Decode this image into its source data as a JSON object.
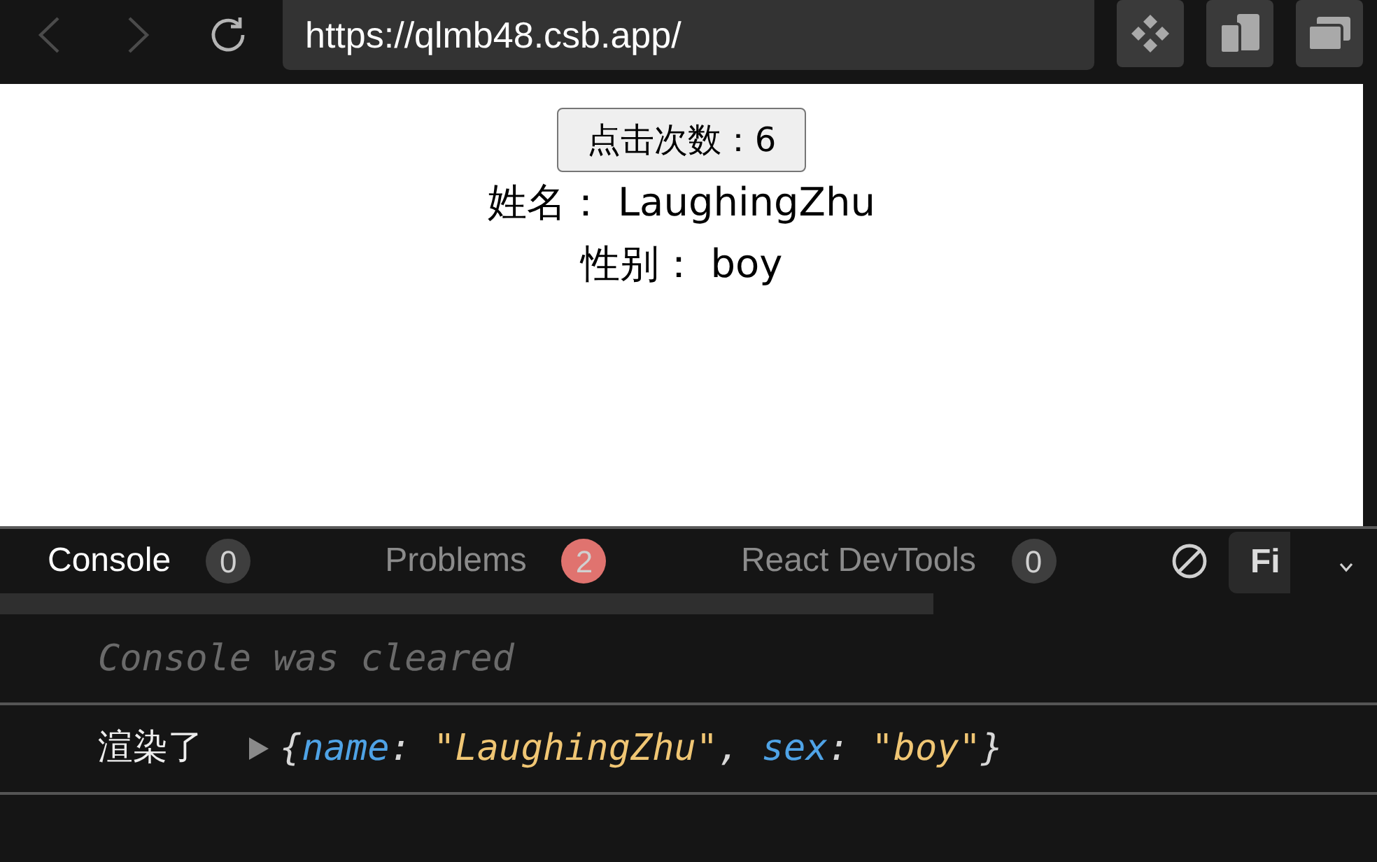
{
  "browser": {
    "nav_buttons": [
      {
        "kind": "back",
        "disabled": true
      },
      {
        "kind": "forward",
        "disabled": true
      },
      {
        "kind": "reload",
        "disabled": false
      }
    ],
    "address": "https://qlmb48.csb.app/",
    "toolbar_buttons": [
      {
        "kind": "diamond"
      },
      {
        "kind": "pages"
      },
      {
        "kind": "windows"
      }
    ]
  },
  "page": {
    "counter_button": "点击次数：6",
    "lines": [
      "姓名： LaughingZhu",
      "性别： boy"
    ]
  },
  "devtools": {
    "tabs": [
      {
        "label": "Console",
        "selected": true,
        "badge": {
          "text": "0",
          "color": "#3e3e3e"
        }
      },
      {
        "label": "Problems",
        "selected": false,
        "badge": {
          "text": "2",
          "color": "#e0736f"
        }
      },
      {
        "label": "React DevTools",
        "selected": false,
        "badge": {
          "text": "0",
          "color": "#3e3e3e"
        }
      }
    ],
    "filter_field": {
      "placeholder": "Fi"
    },
    "log_entries": [
      {
        "kind": "info",
        "text": "Console was cleared"
      },
      {
        "kind": "log",
        "label": "渲染了",
        "expanded": false,
        "preview": [
          {
            "kind": "punct",
            "text": "{"
          },
          {
            "kind": "key",
            "text": "name"
          },
          {
            "kind": "punct",
            "text": ": "
          },
          {
            "kind": "string",
            "text": "\"LaughingZhu\""
          },
          {
            "kind": "punct",
            "text": ", "
          },
          {
            "kind": "key",
            "text": "sex"
          },
          {
            "kind": "punct",
            "text": ": "
          },
          {
            "kind": "string",
            "text": "\"boy\""
          },
          {
            "kind": "punct",
            "text": "}"
          }
        ]
      }
    ]
  }
}
